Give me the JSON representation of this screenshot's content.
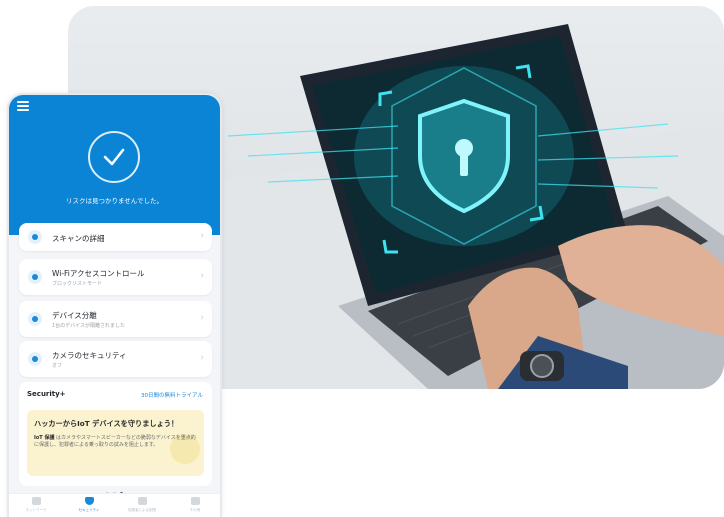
{
  "phone": {
    "status_text": "リスクは見つかりませんでした。",
    "rows": [
      {
        "title": "スキャンの詳細",
        "sub": "",
        "icon": "scan-icon"
      },
      {
        "title": "Wi-Fiアクセスコントロール",
        "sub": "ブロックリストモード",
        "icon": "wifi-users-icon"
      },
      {
        "title": "デバイス分離",
        "sub": "1台のデバイスが隔離されました",
        "icon": "device-isolation-icon"
      },
      {
        "title": "カメラのセキュリティ",
        "sub": "オフ",
        "icon": "camera-security-icon"
      }
    ],
    "security_plus": {
      "title": "Security+",
      "trial_link": "30日間の無料トライアル",
      "promo_title": "ハッカーからIoT デバイスを守りましょう！",
      "promo_bold": "IoT 保護",
      "promo_text": " はカメラやスマートスピーカーなどの脆弱なデバイスを重点的に保護し、犯罪者による乗っ取りの試みを阻止します。"
    },
    "pager": {
      "count": 3,
      "active": 2
    },
    "tabs": [
      {
        "label": "ネットワーク",
        "icon": "network-icon",
        "active": false
      },
      {
        "label": "セキュリティ",
        "icon": "shield-icon",
        "active": true
      },
      {
        "label": "保護者による制限",
        "icon": "parental-icon",
        "active": false
      },
      {
        "label": "その他",
        "icon": "more-icon",
        "active": false
      }
    ]
  },
  "colors": {
    "header_blue": "#0b84d6",
    "accent_blue": "#1a8ad8",
    "promo_yellow": "#fbf3cf",
    "shield_cyan": "#3fe3f0"
  }
}
